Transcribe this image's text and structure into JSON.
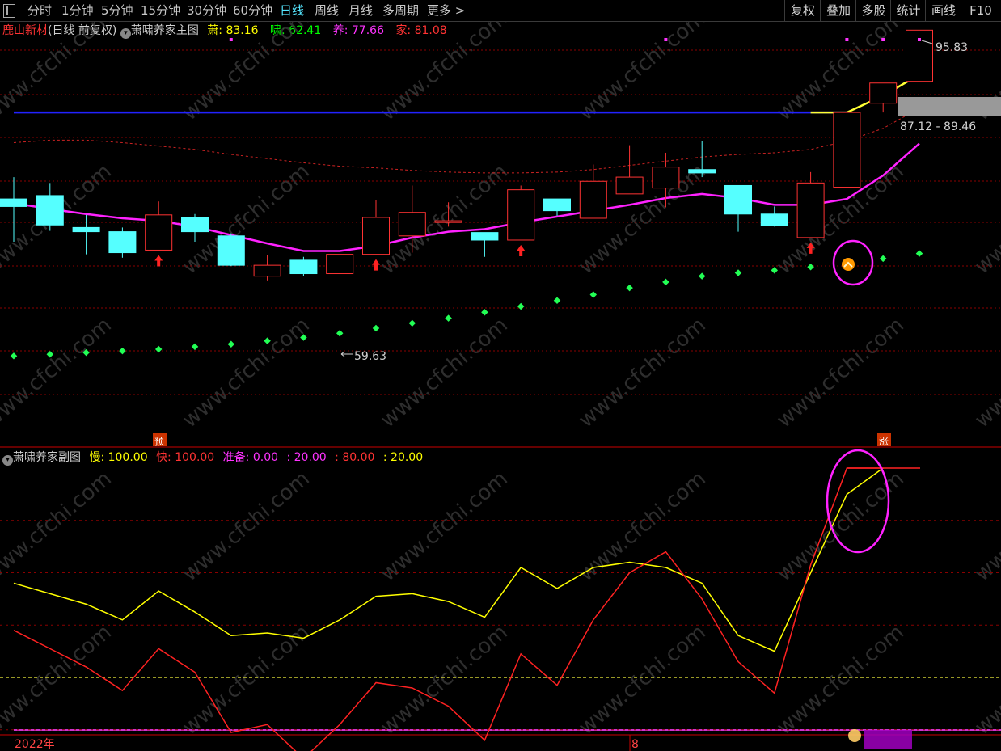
{
  "toolbar": {
    "periods": [
      "分时",
      "1分钟",
      "5分钟",
      "15分钟",
      "30分钟",
      "60分钟",
      "日线",
      "周线",
      "月线",
      "多周期",
      "更多 >"
    ],
    "active_period": "日线",
    "right_buttons": [
      "复权",
      "叠加",
      "多股",
      "统计",
      "画线",
      "F10"
    ]
  },
  "main_legend": {
    "stock_name": "鹿山新材",
    "mode": "(日线 前复权)",
    "indicator_name": "萧啸养家主图",
    "items": [
      {
        "label": "萧:",
        "value": "83.16",
        "color": "#ffff00"
      },
      {
        "label": "啸:",
        "value": "62.41",
        "color": "#00ff00"
      },
      {
        "label": "养:",
        "value": "77.66",
        "color": "#ff33ff"
      },
      {
        "label": "家:",
        "value": "81.08",
        "color": "#ff3333"
      }
    ]
  },
  "sub_legend": {
    "indicator_name": "萧啸养家副图",
    "items": [
      {
        "text": "慢: 100.00",
        "color": "#ffff00"
      },
      {
        "text": "快: 100.00",
        "color": "#ff3333"
      },
      {
        "text": "准备: 0.00",
        "color": "#ff33ff"
      },
      {
        "text": ": 20.00",
        "color": "#ff33ff"
      },
      {
        "text": ": 80.00",
        "color": "#ff3333"
      },
      {
        "text": ": 20.00",
        "color": "#ffff00"
      }
    ]
  },
  "annotations": {
    "high_label": "95.83",
    "low_label": "59.63",
    "range_label": "87.12 - 89.46",
    "yu_marker": "预",
    "zhang_marker": "涨",
    "year_label": "2022年",
    "month_label": "8",
    "watermark": "www.cfchi.com"
  },
  "colors": {
    "up": "#ff3333",
    "down": "#55ffff",
    "ma": "#ff22ff",
    "dots": "#22ff55",
    "resistance": "#2222ff",
    "slow": "#ffff00",
    "fast": "#ff2222",
    "grid": "#8a0000"
  },
  "chart_data": {
    "type": "candlestick",
    "main": {
      "price_range": [
        52.6,
        98.5
      ],
      "candles": [
        {
          "o": 75.7,
          "h": 78.3,
          "l": 70.6,
          "c": 74.8
        },
        {
          "o": 76.1,
          "h": 77.6,
          "l": 71.9,
          "c": 72.6
        },
        {
          "o": 72.3,
          "h": 73.8,
          "l": 69.1,
          "c": 71.8
        },
        {
          "o": 71.8,
          "h": 72.3,
          "l": 68.7,
          "c": 69.3
        },
        {
          "o": 69.6,
          "h": 75.4,
          "l": 69.6,
          "c": 73.8
        },
        {
          "o": 73.5,
          "h": 73.9,
          "l": 70.6,
          "c": 71.8
        },
        {
          "o": 71.3,
          "h": 71.6,
          "l": 67.7,
          "c": 67.8
        },
        {
          "o": 66.5,
          "h": 69.0,
          "l": 66.0,
          "c": 67.8
        },
        {
          "o": 68.4,
          "h": 68.8,
          "l": 66.5,
          "c": 66.8
        },
        {
          "o": 66.8,
          "h": 69.1,
          "l": 66.8,
          "c": 69.1
        },
        {
          "o": 69.1,
          "h": 75.6,
          "l": 69.1,
          "c": 73.5
        },
        {
          "o": 71.3,
          "h": 77.3,
          "l": 69.3,
          "c": 74.1
        },
        {
          "o": 72.9,
          "h": 75.3,
          "l": 72.4,
          "c": 73.1
        },
        {
          "o": 71.7,
          "h": 71.7,
          "l": 68.8,
          "c": 70.8
        },
        {
          "o": 70.8,
          "h": 77.3,
          "l": 70.8,
          "c": 76.8
        },
        {
          "o": 75.7,
          "h": 75.7,
          "l": 73.7,
          "c": 74.3
        },
        {
          "o": 73.4,
          "h": 79.8,
          "l": 73.4,
          "c": 77.8
        },
        {
          "o": 76.3,
          "h": 82.1,
          "l": 76.3,
          "c": 78.3
        },
        {
          "o": 77.0,
          "h": 81.2,
          "l": 74.7,
          "c": 79.5
        },
        {
          "o": 79.2,
          "h": 82.6,
          "l": 78.3,
          "c": 78.8
        },
        {
          "o": 77.3,
          "h": 77.3,
          "l": 71.8,
          "c": 73.9
        },
        {
          "o": 73.9,
          "h": 74.8,
          "l": 72.4,
          "c": 72.5
        },
        {
          "o": 71.1,
          "h": 78.9,
          "l": 71.1,
          "c": 77.6
        },
        {
          "o": 77.1,
          "h": 86.2,
          "l": 77.1,
          "c": 86.0
        },
        {
          "o": 87.1,
          "h": 89.5,
          "l": 86.0,
          "c": 89.5
        },
        {
          "o": 89.7,
          "h": 95.8,
          "l": 89.7,
          "c": 95.8
        }
      ],
      "ma": [
        75.2,
        74.5,
        73.9,
        73.4,
        73.1,
        72.4,
        71.4,
        70.4,
        69.5,
        69.5,
        70.1,
        71.1,
        71.8,
        72.1,
        72.9,
        73.6,
        74.3,
        75.0,
        75.8,
        76.3,
        75.8,
        75.0,
        75.0,
        75.7,
        78.5,
        82.3
      ],
      "dots": [
        57.0,
        57.2,
        57.4,
        57.6,
        57.8,
        58.1,
        58.4,
        58.8,
        59.2,
        59.7,
        60.3,
        60.9,
        61.5,
        62.2,
        62.9,
        63.6,
        64.3,
        65.1,
        65.8,
        66.5,
        66.9,
        67.2,
        67.6,
        68.1,
        68.6,
        69.2
      ],
      "upper_band": [
        82.4,
        82.7,
        82.7,
        82.4,
        82.0,
        81.6,
        81.0,
        80.5,
        80.0,
        79.6,
        79.4,
        79.1,
        78.9,
        78.8,
        78.8,
        78.9,
        79.2,
        79.7,
        80.2,
        80.7,
        81.0,
        81.2,
        81.6,
        82.6,
        84.1,
        86.5
      ],
      "resistance": 86.0,
      "tail_line": [
        86.0,
        86.0,
        88.0,
        90.5
      ],
      "buy_arrows": [
        4,
        10,
        14,
        22
      ]
    },
    "sub": {
      "range": [
        -15,
        115
      ],
      "slow": [
        56,
        52,
        48,
        42,
        53,
        45,
        36,
        37,
        35,
        42,
        51,
        52,
        49,
        43,
        62,
        54,
        62,
        64,
        62,
        56,
        36,
        30,
        60,
        90,
        100
      ],
      "fast": [
        38,
        31,
        24,
        15,
        31,
        22,
        -1,
        2,
        -11,
        2,
        18,
        16,
        9,
        -4,
        29,
        17,
        42,
        60,
        68,
        50,
        26,
        14,
        63,
        100,
        100
      ],
      "levels": [
        0,
        20,
        40,
        60,
        80
      ],
      "upper_line": 100
    }
  }
}
